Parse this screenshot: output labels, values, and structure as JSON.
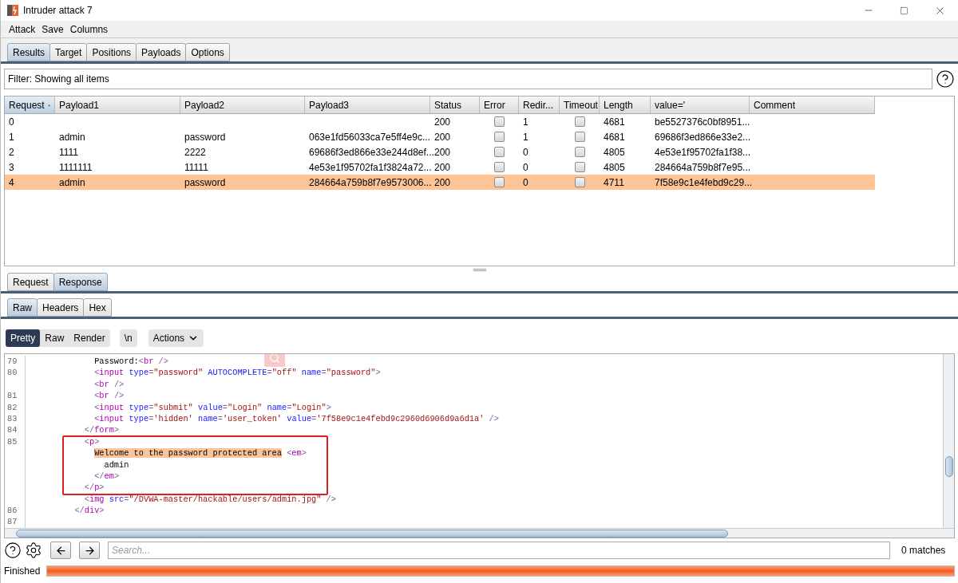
{
  "window": {
    "title": "Intruder attack 7"
  },
  "menu": [
    "Attack",
    "Save",
    "Columns"
  ],
  "tabs": [
    {
      "label": "Results",
      "selected": true
    },
    {
      "label": "Target",
      "selected": false
    },
    {
      "label": "Positions",
      "selected": false
    },
    {
      "label": "Payloads",
      "selected": false
    },
    {
      "label": "Options",
      "selected": false
    }
  ],
  "filter": {
    "text": "Filter: Showing all items"
  },
  "table": {
    "columns": [
      {
        "label": "Request",
        "sorted": true
      },
      {
        "label": "Payload1",
        "sorted": false
      },
      {
        "label": "Payload2",
        "sorted": false
      },
      {
        "label": "Payload3",
        "sorted": false
      },
      {
        "label": "Status",
        "sorted": false
      },
      {
        "label": "Error",
        "sorted": false
      },
      {
        "label": "Redir...",
        "sorted": false
      },
      {
        "label": "Timeout",
        "sorted": false
      },
      {
        "label": "Length",
        "sorted": false
      },
      {
        "label": "value='",
        "sorted": false
      },
      {
        "label": "Comment",
        "sorted": false
      }
    ],
    "rows": [
      {
        "selected": false,
        "request": "0",
        "payload1": "",
        "payload2": "",
        "payload3": "",
        "status": "200",
        "error": false,
        "redirects": "1",
        "timeout": false,
        "length": "4681",
        "value": "be5527376c0bf8951..."
      },
      {
        "selected": false,
        "request": "1",
        "payload1": "admin",
        "payload2": "password",
        "payload3": "063e1fd56033ca7e5ff4e9c...",
        "status": "200",
        "error": false,
        "redirects": "1",
        "timeout": false,
        "length": "4681",
        "value": "69686f3ed866e33e2..."
      },
      {
        "selected": false,
        "request": "2",
        "payload1": "1111",
        "payload2": "2222",
        "payload3": "69686f3ed866e33e244d8ef...",
        "status": "200",
        "error": false,
        "redirects": "0",
        "timeout": false,
        "length": "4805",
        "value": "4e53e1f95702fa1f38..."
      },
      {
        "selected": false,
        "request": "3",
        "payload1": "1111111",
        "payload2": "11111",
        "payload3": "4e53e1f95702fa1f3824a72...",
        "status": "200",
        "error": false,
        "redirects": "0",
        "timeout": false,
        "length": "4805",
        "value": "284664a759b8f7e95..."
      },
      {
        "selected": true,
        "request": "4",
        "payload1": "admin",
        "payload2": "password",
        "payload3": "284664a759b8f7e9573006...",
        "status": "200",
        "error": false,
        "redirects": "0",
        "timeout": false,
        "length": "4711",
        "value": "7f58e9c1e4febd9c29..."
      }
    ]
  },
  "message_tabs": [
    {
      "label": "Request",
      "selected": false
    },
    {
      "label": "Response",
      "selected": true
    }
  ],
  "view_tabs": [
    {
      "label": "Raw",
      "selected": true
    },
    {
      "label": "Headers",
      "selected": false
    },
    {
      "label": "Hex",
      "selected": false
    }
  ],
  "format_buttons": [
    {
      "label": "Pretty",
      "selected": true
    },
    {
      "label": "Raw",
      "selected": false
    },
    {
      "label": "Render",
      "selected": false
    }
  ],
  "newline_button": "\\n",
  "actions_button": "Actions",
  "code": [
    {
      "kind": "line",
      "number": "79",
      "tokens": [
        {
          "kind": "text",
          "text": "            Password:"
        },
        {
          "kind": "punct",
          "text": "<"
        },
        {
          "kind": "tag",
          "text": "br"
        },
        {
          "kind": "punct",
          "text": " />"
        }
      ]
    },
    {
      "kind": "line",
      "number": "80",
      "tokens": [
        {
          "kind": "punct",
          "text": "            <"
        },
        {
          "kind": "tag",
          "text": "input"
        },
        {
          "kind": "attr",
          "text": " type"
        },
        {
          "kind": "punct",
          "text": "="
        },
        {
          "kind": "value",
          "text": "\"password\""
        },
        {
          "kind": "attr",
          "text": " AUTOCOMPLETE"
        },
        {
          "kind": "punct",
          "text": "="
        },
        {
          "kind": "value",
          "text": "\"off\""
        },
        {
          "kind": "attr",
          "text": " name"
        },
        {
          "kind": "punct",
          "text": "="
        },
        {
          "kind": "value",
          "text": "\"password\""
        },
        {
          "kind": "punct",
          "text": ">"
        }
      ]
    },
    {
      "kind": "line",
      "tokens": [
        {
          "kind": "punct",
          "text": "            <"
        },
        {
          "kind": "tag",
          "text": "br"
        },
        {
          "kind": "punct",
          "text": " />"
        }
      ]
    },
    {
      "kind": "line",
      "number": "81",
      "tokens": [
        {
          "kind": "punct",
          "text": "            <"
        },
        {
          "kind": "tag",
          "text": "br"
        },
        {
          "kind": "punct",
          "text": " />"
        }
      ]
    },
    {
      "kind": "line",
      "number": "82",
      "tokens": [
        {
          "kind": "punct",
          "text": "            <"
        },
        {
          "kind": "tag",
          "text": "input"
        },
        {
          "kind": "attr",
          "text": " type"
        },
        {
          "kind": "punct",
          "text": "="
        },
        {
          "kind": "value",
          "text": "\"submit\""
        },
        {
          "kind": "attr",
          "text": " value"
        },
        {
          "kind": "punct",
          "text": "="
        },
        {
          "kind": "value",
          "text": "\"Login\""
        },
        {
          "kind": "attr",
          "text": " name"
        },
        {
          "kind": "punct",
          "text": "="
        },
        {
          "kind": "value",
          "text": "\"Login\""
        },
        {
          "kind": "punct",
          "text": ">"
        }
      ]
    },
    {
      "kind": "line",
      "number": "83",
      "tokens": [
        {
          "kind": "punct",
          "text": "            <"
        },
        {
          "kind": "tag",
          "text": "input"
        },
        {
          "kind": "attr",
          "text": " type"
        },
        {
          "kind": "punct",
          "text": "="
        },
        {
          "kind": "value",
          "text": "'hidden'"
        },
        {
          "kind": "attr",
          "text": " name"
        },
        {
          "kind": "punct",
          "text": "="
        },
        {
          "kind": "value",
          "text": "'user_token'"
        },
        {
          "kind": "attr",
          "text": " value"
        },
        {
          "kind": "punct",
          "text": "="
        },
        {
          "kind": "value",
          "text": "'7f58e9c1e4febd9c2960d6906d9a6d1a'"
        },
        {
          "kind": "punct",
          "text": " />"
        }
      ]
    },
    {
      "kind": "line",
      "number": "84",
      "tokens": [
        {
          "kind": "punct",
          "text": "          </"
        },
        {
          "kind": "tag",
          "text": "form"
        },
        {
          "kind": "punct",
          "text": ">"
        }
      ]
    },
    {
      "kind": "box",
      "lines": [
        {
          "kind": "line",
          "number": "85",
          "tokens": [
            {
              "kind": "punct",
              "text": "          <"
            },
            {
              "kind": "tag",
              "text": "p"
            },
            {
              "kind": "punct",
              "text": ">"
            }
          ]
        },
        {
          "kind": "line",
          "tokens": [
            {
              "kind": "highlight",
              "text": "            Welcome to the password protected area"
            },
            {
              "kind": "punct",
              "text": " <"
            },
            {
              "kind": "tag",
              "text": "em"
            },
            {
              "kind": "punct",
              "text": ">"
            }
          ]
        },
        {
          "kind": "line",
          "tokens": [
            {
              "kind": "text",
              "text": "              admin"
            }
          ]
        },
        {
          "kind": "line",
          "tokens": [
            {
              "kind": "punct",
              "text": "            </"
            },
            {
              "kind": "tag",
              "text": "em"
            },
            {
              "kind": "punct",
              "text": ">"
            }
          ]
        },
        {
          "kind": "line",
          "tokens": [
            {
              "kind": "punct",
              "text": "          </"
            },
            {
              "kind": "tag",
              "text": "p"
            },
            {
              "kind": "punct",
              "text": ">"
            }
          ]
        }
      ]
    },
    {
      "kind": "line",
      "tokens": [
        {
          "kind": "punct",
          "text": "          <"
        },
        {
          "kind": "tag",
          "text": "img"
        },
        {
          "kind": "attr",
          "text": " src"
        },
        {
          "kind": "punct",
          "text": "="
        },
        {
          "kind": "value",
          "text": "\"/DVWA-master/hackable/users/admin.jpg\""
        },
        {
          "kind": "punct",
          "text": " />"
        }
      ]
    },
    {
      "kind": "line",
      "number": "86",
      "tokens": [
        {
          "kind": "punct",
          "text": "        </"
        },
        {
          "kind": "tag",
          "text": "div"
        },
        {
          "kind": "punct",
          "text": ">"
        }
      ]
    },
    {
      "kind": "line",
      "number": "87"
    }
  ],
  "search": {
    "placeholder": "Search...",
    "matches": "0 matches"
  },
  "status": {
    "text": "Finished",
    "level": 1
  }
}
